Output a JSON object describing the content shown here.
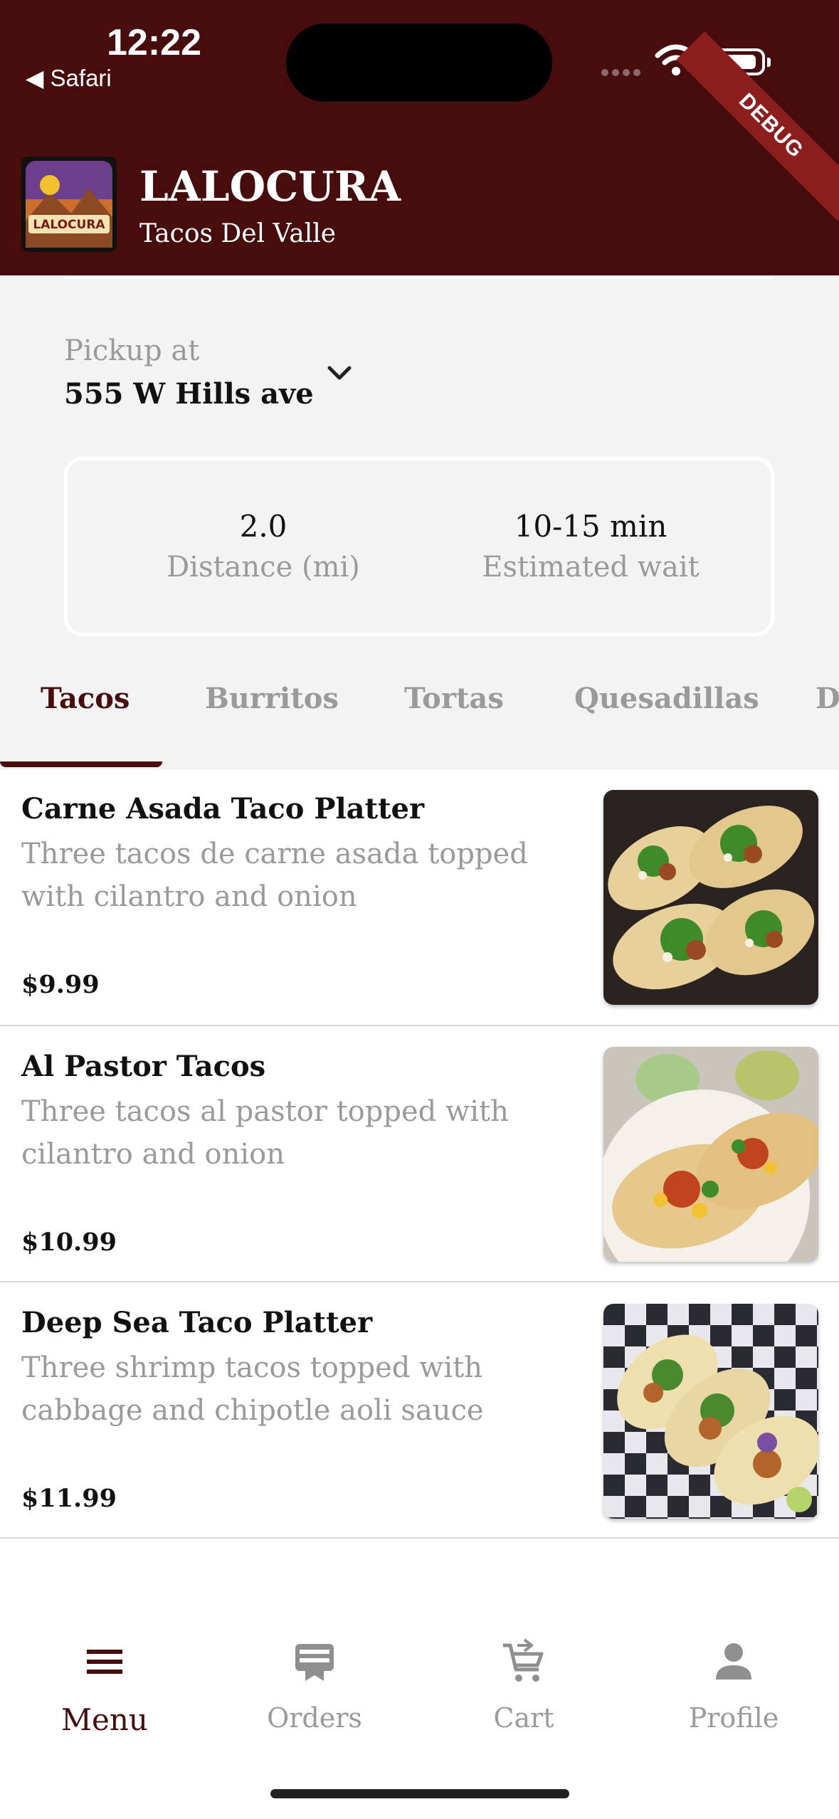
{
  "status_bar": {
    "time": "12:22",
    "back_label": "◀ Safari",
    "debug_label": "DEBUG"
  },
  "header": {
    "logo_text": "LALOCURA",
    "restaurant_name": "LALOCURA",
    "location_name": "Tacos Del Valle"
  },
  "pickup": {
    "label": "Pickup at",
    "address": "555 W Hills ave"
  },
  "stats": {
    "distance_value": "2.0",
    "distance_label": "Distance (mi)",
    "wait_value": "10-15 min",
    "wait_label": "Estimated wait"
  },
  "tabs": [
    {
      "label": "Tacos"
    },
    {
      "label": "Burritos"
    },
    {
      "label": "Tortas"
    },
    {
      "label": "Quesadillas"
    },
    {
      "label": "D"
    }
  ],
  "menu_items": [
    {
      "title": "Carne Asada Taco Platter",
      "description": "Three tacos de carne asada topped with cilantro and onion",
      "price": "$9.99"
    },
    {
      "title": "Al Pastor Tacos",
      "description": "Three tacos al pastor topped with cilantro and onion",
      "price": "$10.99"
    },
    {
      "title": "Deep Sea Taco Platter",
      "description": "Three shrimp tacos topped with cabbage and chipotle aoli sauce",
      "price": "$11.99"
    }
  ],
  "nav": [
    {
      "label": "Menu",
      "icon": "menu-icon"
    },
    {
      "label": "Orders",
      "icon": "orders-icon"
    },
    {
      "label": "Cart",
      "icon": "cart-icon"
    },
    {
      "label": "Profile",
      "icon": "profile-icon"
    }
  ],
  "colors": {
    "brand": "#470c0c",
    "muted": "#9a9a9a",
    "background": "#f3f3f3"
  }
}
